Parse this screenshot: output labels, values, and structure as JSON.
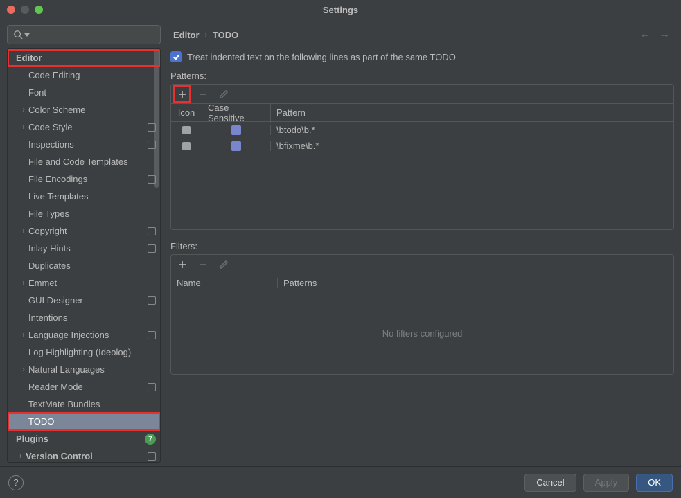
{
  "window": {
    "title": "Settings"
  },
  "breadcrumb": {
    "a": "Editor",
    "b": "TODO"
  },
  "checkbox": {
    "label": "Treat indented text on the following lines as part of the same TODO",
    "checked": true
  },
  "patterns": {
    "label": "Patterns:",
    "headers": {
      "icon": "Icon",
      "cs": "Case Sensitive",
      "pattern": "Pattern"
    },
    "rows": [
      {
        "pattern": "\\btodo\\b.*"
      },
      {
        "pattern": "\\bfixme\\b.*"
      }
    ]
  },
  "filters": {
    "label": "Filters:",
    "headers": {
      "name": "Name",
      "patterns": "Patterns"
    },
    "empty": "No filters configured"
  },
  "sidebar": {
    "items": [
      {
        "label": "Editor",
        "level": 0,
        "highlight": true
      },
      {
        "label": "Code Editing",
        "level": 1
      },
      {
        "label": "Font",
        "level": 1
      },
      {
        "label": "Color Scheme",
        "level": 1,
        "chev": true
      },
      {
        "label": "Code Style",
        "level": 1,
        "chev": true,
        "gear": true
      },
      {
        "label": "Inspections",
        "level": 1,
        "gear": true
      },
      {
        "label": "File and Code Templates",
        "level": 1
      },
      {
        "label": "File Encodings",
        "level": 1,
        "gear": true
      },
      {
        "label": "Live Templates",
        "level": 1
      },
      {
        "label": "File Types",
        "level": 1
      },
      {
        "label": "Copyright",
        "level": 1,
        "chev": true,
        "gear": true
      },
      {
        "label": "Inlay Hints",
        "level": 1,
        "gear": true
      },
      {
        "label": "Duplicates",
        "level": 1
      },
      {
        "label": "Emmet",
        "level": 1,
        "chev": true
      },
      {
        "label": "GUI Designer",
        "level": 1,
        "gear": true
      },
      {
        "label": "Intentions",
        "level": 1
      },
      {
        "label": "Language Injections",
        "level": 1,
        "chev": true,
        "gear": true
      },
      {
        "label": "Log Highlighting (Ideolog)",
        "level": 1
      },
      {
        "label": "Natural Languages",
        "level": 1,
        "chev": true
      },
      {
        "label": "Reader Mode",
        "level": 1,
        "gear": true
      },
      {
        "label": "TextMate Bundles",
        "level": 1
      },
      {
        "label": "TODO",
        "level": 1,
        "selected": true,
        "highlight": true
      },
      {
        "label": "Plugins",
        "level": 0,
        "badge": "7"
      },
      {
        "label": "Version Control",
        "level": 0,
        "chev": true,
        "gear": true
      }
    ]
  },
  "buttons": {
    "cancel": "Cancel",
    "apply": "Apply",
    "ok": "OK"
  }
}
